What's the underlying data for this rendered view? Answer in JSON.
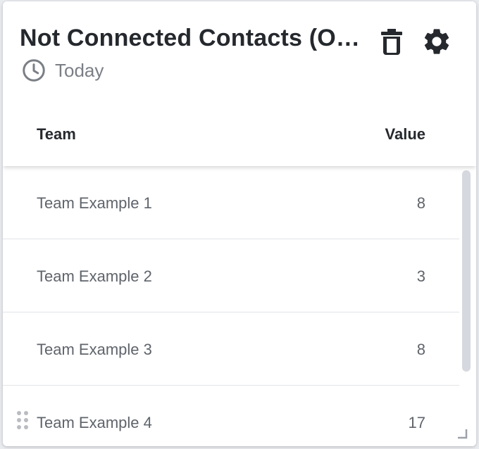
{
  "widget": {
    "title": "Not Connected Contacts (Outbound)",
    "period": "Today",
    "actions": {
      "delete_icon": "trash-icon",
      "settings_icon": "gear-icon"
    }
  },
  "table": {
    "columns": [
      "Team",
      "Value"
    ],
    "rows": [
      {
        "team": "Team Example 1",
        "value": "8"
      },
      {
        "team": "Team Example 2",
        "value": "3"
      },
      {
        "team": "Team Example 3",
        "value": "8"
      },
      {
        "team": "Team Example 4",
        "value": "17"
      }
    ]
  },
  "colors": {
    "title": "#25292e",
    "muted_text": "#7a7f86",
    "cell_text": "#5f646b",
    "row_divider": "#e2e4e8",
    "scrollbar_thumb": "#d5d8de"
  }
}
